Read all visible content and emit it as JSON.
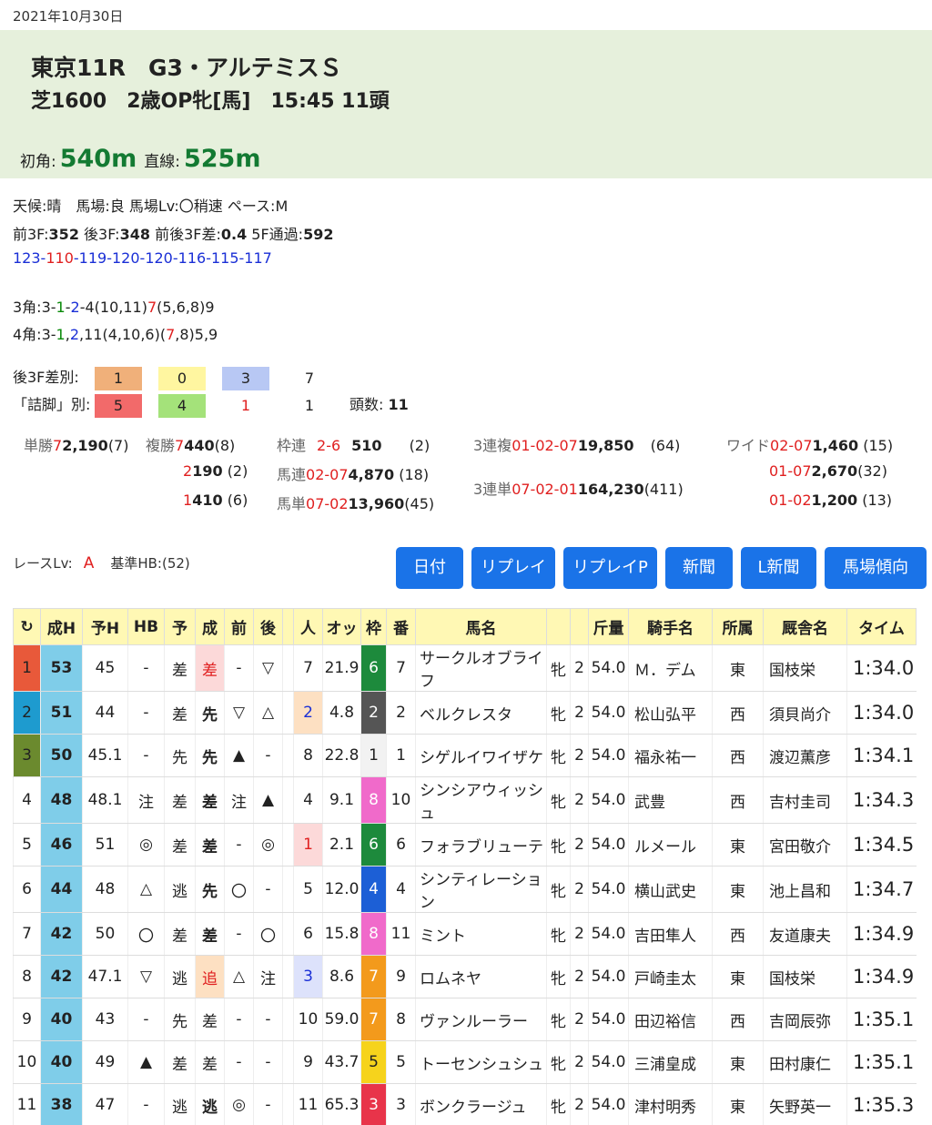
{
  "date": "2021年10月30日",
  "header": {
    "title": "東京11R　G3・アルテミスＳ",
    "sub": "芝1600　2歳OP牝[馬]　15:45 11頭",
    "first_corner_label": "初角:",
    "first_corner": "540m",
    "straight_label": "直線:",
    "straight": "525m"
  },
  "conditions": {
    "line": "天候:晴　馬場:良 馬場Lv:〇稍速 ペース:M",
    "f3_label": "前3F:",
    "f3": "352",
    "l3_label": " 後3F:",
    "l3": "348",
    "diff_label": " 前後3F差:",
    "diff": "0.4",
    "f5_label": " 5F通過:",
    "f5": "592"
  },
  "laps": [
    {
      "v": "123",
      "c": "blue"
    },
    {
      "v": "110",
      "c": "red"
    },
    {
      "v": "119",
      "c": "blue"
    },
    {
      "v": "120",
      "c": "blue"
    },
    {
      "v": "120",
      "c": "blue"
    },
    {
      "v": "116",
      "c": "blue"
    },
    {
      "v": "115",
      "c": "blue"
    },
    {
      "v": "117",
      "c": "blue"
    }
  ],
  "corners": {
    "c3_label": "3角:",
    "c4_label": "4角:"
  },
  "stats": {
    "row1_label": "後3F差別:",
    "row1": [
      {
        "v": "1",
        "bg": "#f0b07a",
        "c": "#222"
      },
      {
        "v": "0",
        "bg": "#fff6a0",
        "c": "#222"
      },
      {
        "v": "3",
        "bg": "#b8c8f4",
        "c": "#222"
      },
      {
        "v": "7",
        "bg": "transparent",
        "c": "#222"
      }
    ],
    "row2_label": "「詰脚」別:",
    "row2": [
      {
        "v": "5",
        "bg": "#f26a6a",
        "c": "#222"
      },
      {
        "v": "4",
        "bg": "#a4e27a",
        "c": "#222"
      },
      {
        "v": "1",
        "bg": "transparent",
        "c": "#e02020"
      },
      {
        "v": "1",
        "bg": "transparent",
        "c": "#222"
      }
    ],
    "count_label": "頭数:",
    "count": "11"
  },
  "payouts": {
    "tansho_label": "単勝",
    "tansho_num": "7",
    "tansho_amt": "2,190",
    "tansho_pop": "(7)",
    "fukusho_label": "複勝",
    "fukusho": [
      {
        "num": "7",
        "amt": "440",
        "pop": "(8)"
      },
      {
        "num": "2",
        "amt": "190",
        "pop": "(2)"
      },
      {
        "num": "1",
        "amt": "410",
        "pop": "(6)"
      }
    ],
    "wakuren_label": "枠連",
    "wakuren_num": "2-6",
    "wakuren_amt": "510",
    "wakuren_pop": "(2)",
    "umaren_label": "馬連",
    "umaren_num": "02-07",
    "umaren_amt": "4,870",
    "umaren_pop": "(18)",
    "umatan_label": "馬単",
    "umatan_num": "07-02",
    "umatan_amt": "13,960",
    "umatan_pop": "(45)",
    "trio_label": "3連複",
    "trio_num": "01-02-07",
    "trio_amt": "19,850",
    "trio_pop": "(64)",
    "trifecta_label": "3連単",
    "trifecta_num": "07-02-01",
    "trifecta_amt": "164,230",
    "trifecta_pop": "(411)",
    "wide_label": "ワイド",
    "wide": [
      {
        "num": "02-07",
        "amt": "1,460",
        "pop": "(15)"
      },
      {
        "num": "01-07",
        "amt": "2,670",
        "pop": "(32)"
      },
      {
        "num": "01-02",
        "amt": "1,200",
        "pop": "(13)"
      }
    ]
  },
  "race_level": {
    "label": "レースLv:",
    "value": "A",
    "base_label": "基準HB:(52)"
  },
  "buttons": [
    "日付",
    "リプレイ",
    "リプレイP",
    "新聞",
    "L新聞",
    "馬場傾向"
  ],
  "table": {
    "headers": [
      "↻",
      "成H",
      "予H",
      "HB",
      "予",
      "成",
      "前",
      "後",
      "",
      "人",
      "オッ",
      "枠",
      "番",
      "馬名",
      "",
      "",
      "斤量",
      "騎手名",
      "所属",
      "厩舎名",
      "タイム"
    ],
    "rows": [
      {
        "rank": "1",
        "rank_bg": "#e8593a",
        "seih": "53",
        "yoh": "45",
        "hb": "-",
        "yo": "差",
        "sei": "差",
        "sei_cls": "",
        "sei_bg": "#fcd9d9",
        "mae": "-",
        "ato": "▽",
        "pop": "7",
        "pop_bg": "",
        "odds": "21.9",
        "waku": "6",
        "waku_bg": "#1d8a3c",
        "waku_c": "#fff",
        "ban": "7",
        "name": "サークルオブライフ",
        "sex": "牝",
        "age": "2",
        "kinryo": "54.0",
        "jockey": "Ｍ．デム",
        "aff": "東",
        "stable": "国枝栄",
        "time": "1:34.0"
      },
      {
        "rank": "2",
        "rank_bg": "#1e9bcf",
        "seih": "51",
        "yoh": "44",
        "hb": "-",
        "yo": "差",
        "sei": "先",
        "sei_cls": "c-sei-sen",
        "sei_bg": "",
        "mae": "▽",
        "ato": "△",
        "pop": "2",
        "pop_bg": "#fde0c2",
        "odds": "4.8",
        "waku": "2",
        "waku_bg": "#555555",
        "waku_c": "#fff",
        "ban": "2",
        "name": "ベルクレスタ",
        "sex": "牝",
        "age": "2",
        "kinryo": "54.0",
        "jockey": "松山弘平",
        "aff": "西",
        "stable": "須貝尚介",
        "time": "1:34.0"
      },
      {
        "rank": "3",
        "rank_bg": "#6b8a2e",
        "seih": "50",
        "yoh": "45.1",
        "hb": "-",
        "yo": "先",
        "sei": "先",
        "sei_cls": "c-sei-sen",
        "sei_bg": "",
        "mae": "▲",
        "ato": "-",
        "pop": "8",
        "pop_bg": "",
        "odds": "22.8",
        "waku": "1",
        "waku_bg": "#f2f2f2",
        "waku_c": "#222",
        "ban": "1",
        "name": "シゲルイワイザケ",
        "sex": "牝",
        "age": "2",
        "kinryo": "54.0",
        "jockey": "福永祐一",
        "aff": "西",
        "stable": "渡辺薫彦",
        "time": "1:34.1"
      },
      {
        "rank": "4",
        "rank_bg": "",
        "seih": "48",
        "yoh": "48.1",
        "hb": "注",
        "yo": "差",
        "sei": "差",
        "sei_cls": "c-sei-sa",
        "sei_bg": "",
        "mae": "注",
        "ato": "▲",
        "pop": "4",
        "pop_bg": "",
        "odds": "9.1",
        "waku": "8",
        "waku_bg": "#f06aca",
        "waku_c": "#fff",
        "ban": "10",
        "name": "シンシアウィッシュ",
        "sex": "牝",
        "age": "2",
        "kinryo": "54.0",
        "jockey": "武豊",
        "aff": "西",
        "stable": "吉村圭司",
        "time": "1:34.3"
      },
      {
        "rank": "5",
        "rank_bg": "",
        "seih": "46",
        "yoh": "51",
        "hb": "◎",
        "yo": "差",
        "sei": "差",
        "sei_cls": "c-sei-sa",
        "sei_bg": "",
        "mae": "-",
        "ato": "◎",
        "pop": "1",
        "pop_bg": "#fcd9d9",
        "odds": "2.1",
        "waku": "6",
        "waku_bg": "#1d8a3c",
        "waku_c": "#fff",
        "ban": "6",
        "name": "フォラブリューテ",
        "sex": "牝",
        "age": "2",
        "kinryo": "54.0",
        "jockey": "ルメール",
        "aff": "東",
        "stable": "宮田敬介",
        "time": "1:34.5"
      },
      {
        "rank": "6",
        "rank_bg": "",
        "seih": "44",
        "yoh": "48",
        "hb": "△",
        "yo": "逃",
        "sei": "先",
        "sei_cls": "c-sei-sen",
        "sei_bg": "",
        "mae": "〇",
        "ato": "-",
        "pop": "5",
        "pop_bg": "",
        "odds": "12.0",
        "waku": "4",
        "waku_bg": "#1c5fd6",
        "waku_c": "#fff",
        "ban": "4",
        "name": "シンティレーション",
        "sex": "牝",
        "age": "2",
        "kinryo": "54.0",
        "jockey": "横山武史",
        "aff": "東",
        "stable": "池上昌和",
        "time": "1:34.7"
      },
      {
        "rank": "7",
        "rank_bg": "",
        "seih": "42",
        "yoh": "50",
        "hb": "〇",
        "yo": "差",
        "sei": "差",
        "sei_cls": "c-sei-sa",
        "sei_bg": "",
        "mae": "-",
        "ato": "〇",
        "pop": "6",
        "pop_bg": "",
        "odds": "15.8",
        "waku": "8",
        "waku_bg": "#f06aca",
        "waku_c": "#fff",
        "ban": "11",
        "name": "ミント",
        "sex": "牝",
        "age": "2",
        "kinryo": "54.0",
        "jockey": "吉田隼人",
        "aff": "西",
        "stable": "友道康夫",
        "time": "1:34.9"
      },
      {
        "rank": "8",
        "rank_bg": "",
        "seih": "42",
        "yoh": "47.1",
        "hb": "▽",
        "yo": "逃",
        "sei": "追",
        "sei_cls": "",
        "sei_bg": "#fde0c2",
        "mae": "△",
        "ato": "注",
        "pop": "3",
        "pop_bg": "#dde2fb",
        "odds": "8.6",
        "waku": "7",
        "waku_bg": "#f39a1c",
        "waku_c": "#fff",
        "ban": "9",
        "name": "ロムネヤ",
        "sex": "牝",
        "age": "2",
        "kinryo": "54.0",
        "jockey": "戸崎圭太",
        "aff": "東",
        "stable": "国枝栄",
        "time": "1:34.9"
      },
      {
        "rank": "9",
        "rank_bg": "",
        "seih": "40",
        "yoh": "43",
        "hb": "-",
        "yo": "先",
        "sei": "差",
        "sei_cls": "",
        "sei_bg": "",
        "mae": "-",
        "ato": "-",
        "pop": "10",
        "pop_bg": "",
        "odds": "59.0",
        "waku": "7",
        "waku_bg": "#f39a1c",
        "waku_c": "#fff",
        "ban": "8",
        "name": "ヴァンルーラー",
        "sex": "牝",
        "age": "2",
        "kinryo": "54.0",
        "jockey": "田辺裕信",
        "aff": "西",
        "stable": "吉岡辰弥",
        "time": "1:35.1"
      },
      {
        "rank": "10",
        "rank_bg": "",
        "seih": "40",
        "yoh": "49",
        "hb": "▲",
        "yo": "差",
        "sei": "差",
        "sei_cls": "",
        "sei_bg": "",
        "mae": "-",
        "ato": "-",
        "pop": "9",
        "pop_bg": "",
        "odds": "43.7",
        "waku": "5",
        "waku_bg": "#f6d31c",
        "waku_c": "#222",
        "ban": "5",
        "name": "トーセンシュシュ",
        "sex": "牝",
        "age": "2",
        "kinryo": "54.0",
        "jockey": "三浦皇成",
        "aff": "東",
        "stable": "田村康仁",
        "time": "1:35.1"
      },
      {
        "rank": "11",
        "rank_bg": "",
        "seih": "38",
        "yoh": "47",
        "hb": "-",
        "yo": "逃",
        "sei": "逃",
        "sei_cls": "c-sei-nige",
        "sei_bg": "",
        "mae": "◎",
        "ato": "-",
        "pop": "11",
        "pop_bg": "",
        "odds": "65.3",
        "waku": "3",
        "waku_bg": "#e8344a",
        "waku_c": "#fff",
        "ban": "3",
        "name": "ボンクラージュ",
        "sex": "牝",
        "age": "2",
        "kinryo": "54.0",
        "jockey": "津村明秀",
        "aff": "東",
        "stable": "矢野英一",
        "time": "1:35.3"
      }
    ]
  }
}
